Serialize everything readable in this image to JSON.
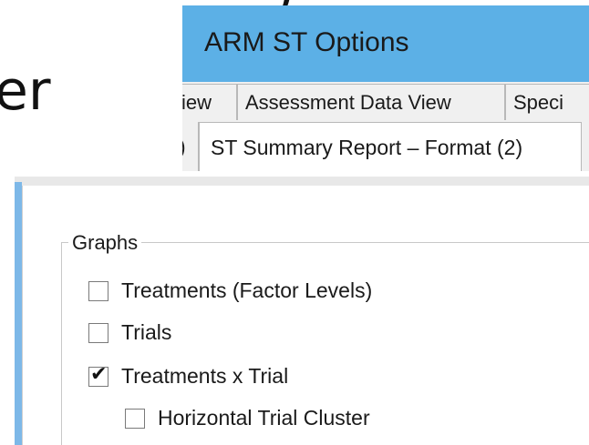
{
  "background": {
    "fragment_top": ")",
    "fragment_main": "er"
  },
  "window": {
    "title": "ARM ST Options",
    "titlebar_color": "#5cb0e6"
  },
  "tabs_row1": [
    {
      "label": "iew"
    },
    {
      "label": "Assessment Data View"
    },
    {
      "label": "Speci"
    }
  ],
  "tabs_row2": [
    {
      "label": ")"
    },
    {
      "label": "ST Summary Report – Format (2)",
      "active": true
    }
  ],
  "graphs_group": {
    "label": "Graphs",
    "options": [
      {
        "label": "Treatments (Factor Levels)",
        "checked": false
      },
      {
        "label": "Trials",
        "checked": false
      },
      {
        "label": "Treatments x Trial",
        "checked": true
      },
      {
        "label": "Horizontal Trial Cluster",
        "checked": false,
        "indent": true
      }
    ]
  },
  "icons": {
    "checkmark": "check-icon"
  }
}
